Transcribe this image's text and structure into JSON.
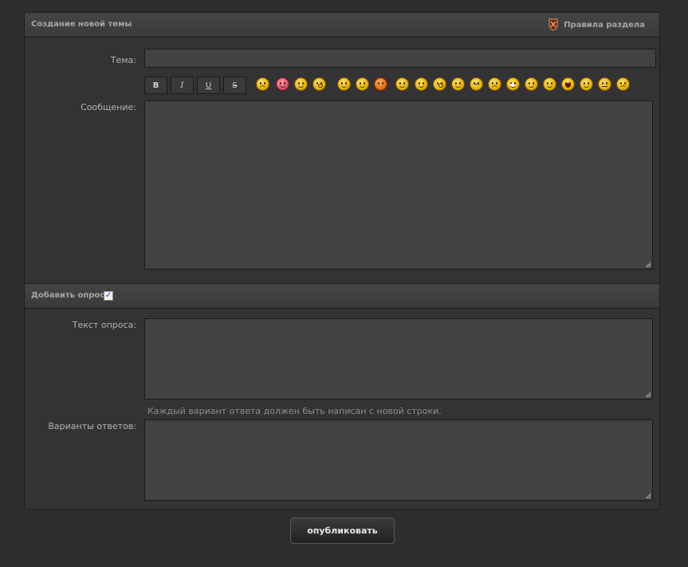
{
  "topic_panel": {
    "title": "Создание новой темы",
    "rules_link": "Правила раздела",
    "subject_label": "Тема:",
    "subject_value": "",
    "message_label": "Сообщение:",
    "message_value": "",
    "toolbar": {
      "bold": "B",
      "italic": "I",
      "underline": "U",
      "strike": "S"
    },
    "smileys_icons": [
      "sad-smiley-icon",
      "love-smiley-icon",
      "happy-smiley-icon",
      "shocked-smiley-icon",
      "tongue-smiley-icon",
      "cool-smiley-icon",
      "warning-smiley-icon",
      "santa-smiley-icon",
      "wink-smiley-icon",
      "surprised-smiley-icon",
      "smile-smiley-icon",
      "confused-smiley-icon",
      "frown-smiley-icon",
      "grin-smiley-icon",
      "rolleyes-smiley-icon",
      "dizzy-smiley-icon",
      "laugh-smiley-icon",
      "dazed-smiley-icon",
      "neutral-smiley-icon",
      "angry-smiley-icon"
    ]
  },
  "poll_panel": {
    "title": "Добавить опрос",
    "checked": true,
    "question_label": "Текст опроса:",
    "question_value": "",
    "hint": "Каждый вариант ответа должен быть написан с новой строки.",
    "answers_label": "Варианты ответов:",
    "answers_value": ""
  },
  "publish_button": "опубликовать"
}
